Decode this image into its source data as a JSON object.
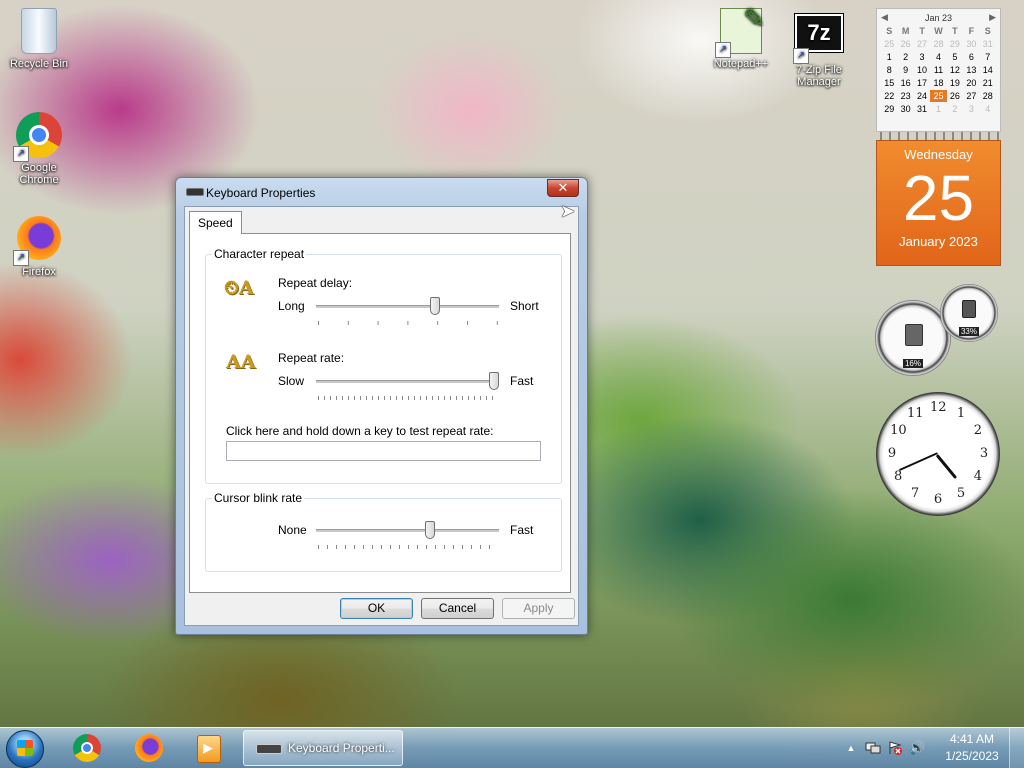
{
  "desktop": {
    "icons": [
      {
        "label": "Recycle Bin"
      },
      {
        "label": "Google Chrome"
      },
      {
        "label": "Firefox"
      },
      {
        "label": "Notepad++"
      },
      {
        "label": "7-Zip File Manager"
      }
    ]
  },
  "calendar_gadget": {
    "month_label": "Jan 23",
    "prev": "◀",
    "next": "▶",
    "weekdays": [
      "S",
      "M",
      "T",
      "W",
      "T",
      "F",
      "S"
    ],
    "weeks": [
      [
        "25",
        "26",
        "27",
        "28",
        "29",
        "30",
        "31"
      ],
      [
        "1",
        "2",
        "3",
        "4",
        "5",
        "6",
        "7"
      ],
      [
        "8",
        "9",
        "10",
        "11",
        "12",
        "13",
        "14"
      ],
      [
        "15",
        "16",
        "17",
        "18",
        "19",
        "20",
        "21"
      ],
      [
        "22",
        "23",
        "24",
        "25",
        "26",
        "27",
        "28"
      ],
      [
        "29",
        "30",
        "31",
        "1",
        "2",
        "3",
        "4"
      ]
    ],
    "today": "25",
    "day_name": "Wednesday",
    "day_number": "25",
    "month_year": "January 2023",
    "accent": "#e67a22"
  },
  "meters_gadget": {
    "cpu": "16%",
    "memory": "33%"
  },
  "clock_gadget": {
    "numerals": [
      "12",
      "1",
      "2",
      "3",
      "4",
      "5",
      "6",
      "7",
      "8",
      "9",
      "10",
      "11"
    ],
    "time": "4:41"
  },
  "dialog": {
    "title": "Keyboard Properties",
    "close_glyph": "✕",
    "tab": "Speed",
    "character_repeat": {
      "title": "Character repeat",
      "repeat_delay": {
        "label": "Repeat delay:",
        "min_label": "Long",
        "max_label": "Short",
        "value_fraction": 0.66
      },
      "repeat_rate": {
        "label": "Repeat rate:",
        "min_label": "Slow",
        "max_label": "Fast",
        "value_fraction": 1.0
      },
      "test_label": "Click here and hold down a key to test repeat rate:",
      "test_value": ""
    },
    "cursor_blink": {
      "title": "Cursor blink rate",
      "min_label": "None",
      "max_label": "Fast",
      "value_fraction": 0.63
    },
    "buttons": {
      "ok": "OK",
      "cancel": "Cancel",
      "apply": "Apply"
    }
  },
  "taskbar": {
    "task_label": "Keyboard Properti...",
    "time": "4:41 AM",
    "date": "1/25/2023",
    "tray_arrow": "▲",
    "volume_glyph": "🔊"
  }
}
